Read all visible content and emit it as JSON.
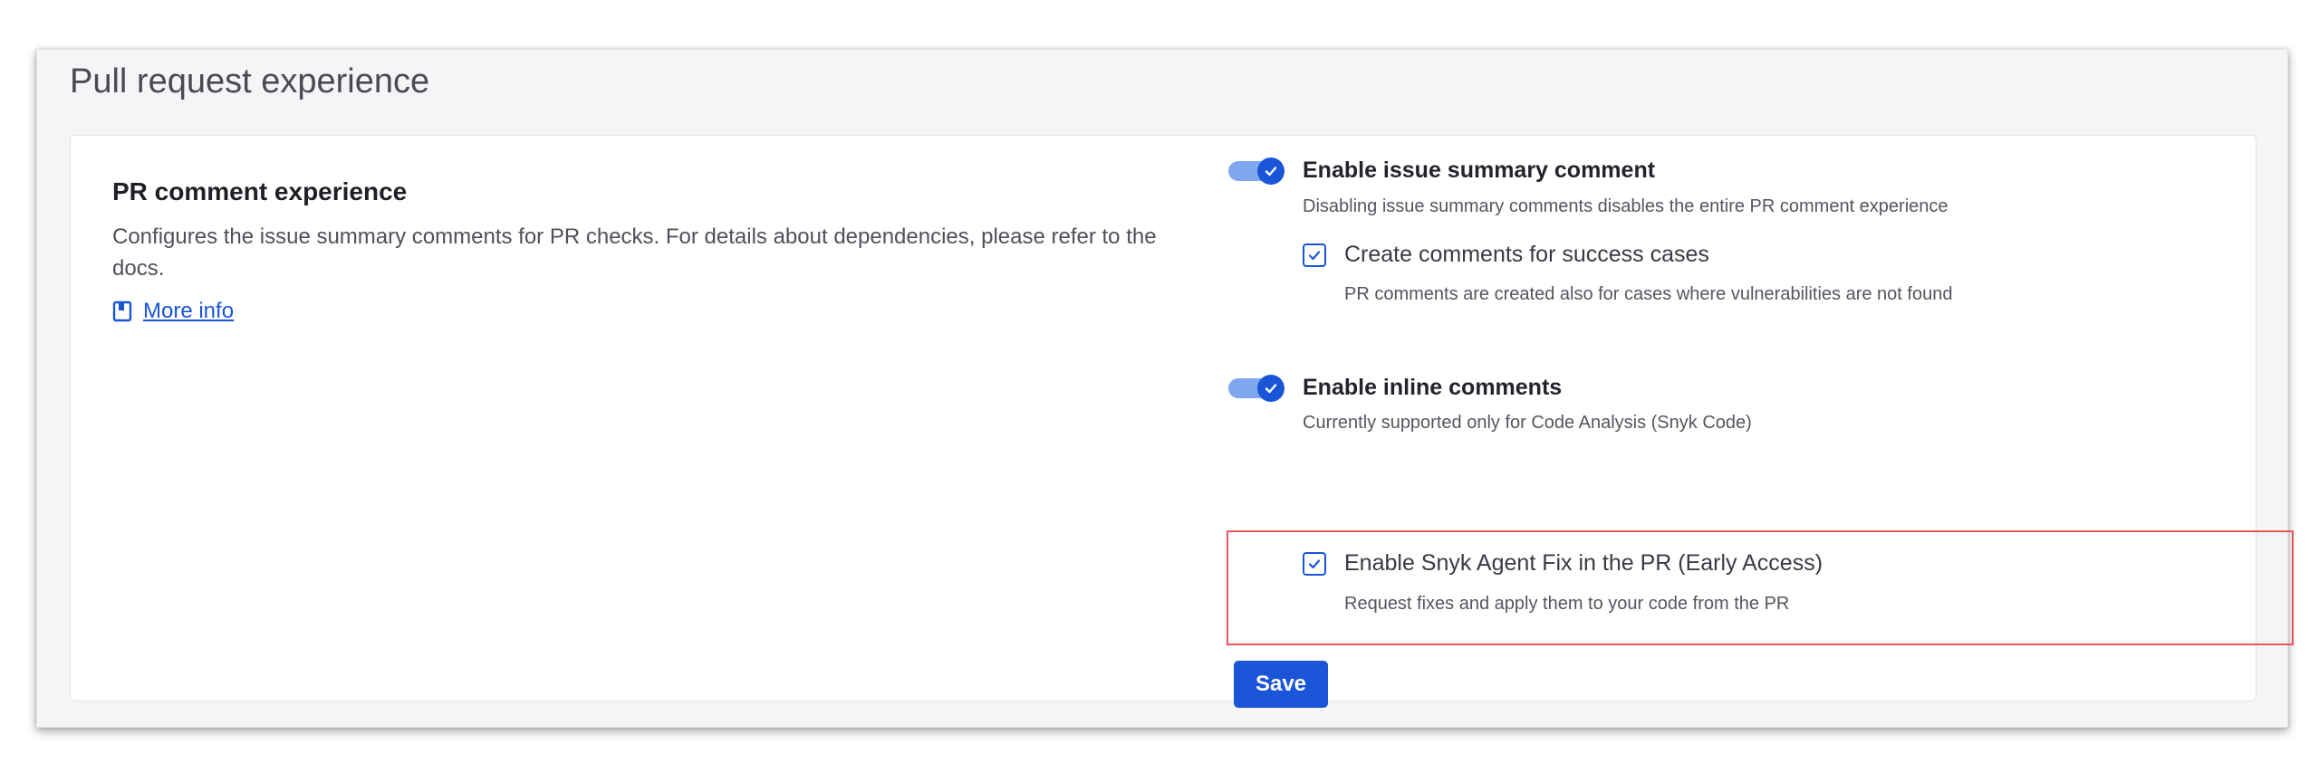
{
  "section": {
    "title": "Pull request experience"
  },
  "pr_comment": {
    "title": "PR comment experience",
    "description": "Configures the issue summary comments for PR checks. For details about dependencies, please refer to the docs.",
    "link_label": "More info",
    "link_icon": "book-icon"
  },
  "options": {
    "issue_summary": {
      "label": "Enable issue summary comment",
      "description": "Disabling issue summary comments disables the entire PR comment experience",
      "enabled": true
    },
    "success_cases": {
      "label": "Create comments for success cases",
      "description": "PR comments are created also for cases where vulnerabilities are not found",
      "checked": true
    },
    "inline_comments": {
      "label": "Enable inline comments",
      "description": "Currently supported only for Code Analysis (Snyk Code)",
      "enabled": true
    },
    "agent_fix": {
      "label": "Enable Snyk Agent Fix in the PR (Early Access)",
      "description": "Request fixes and apply them to your code from the PR",
      "checked": true
    }
  },
  "save_label": "Save",
  "colors": {
    "accent": "#1a55d8",
    "toggle_track": "#7ea7ef",
    "highlight_border": "#e8575a"
  }
}
